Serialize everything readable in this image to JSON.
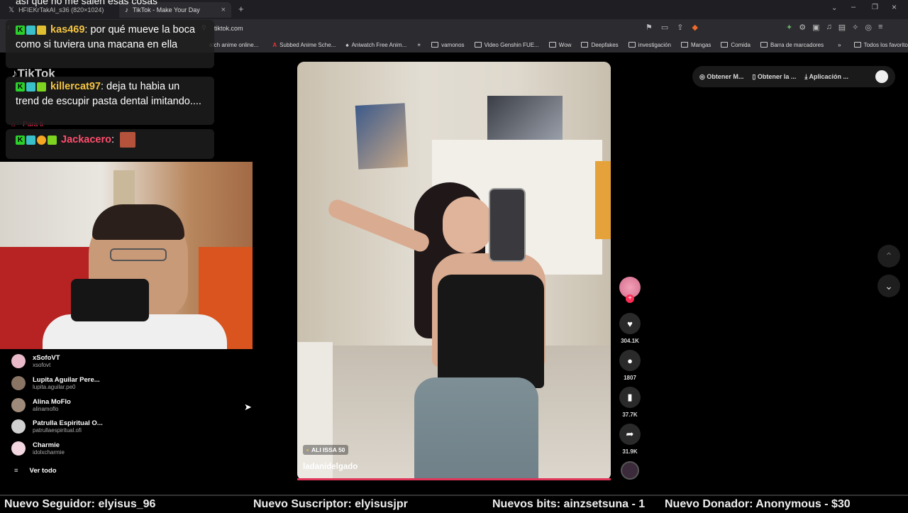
{
  "browser": {
    "tabs": [
      {
        "title": "HFIEKrTakAI_s36 (820×1024)",
        "active": false
      },
      {
        "title": "TikTok - Make Your Day",
        "active": true
      }
    ],
    "url": "tiktok.com",
    "bookmarks": [
      "atch anime online...",
      "Subbed Anime Sche...",
      "Aniwatch Free Anim...",
      "vamonos",
      "Video Genshin FUE...",
      "Wow",
      "Deepfakes",
      "investigación",
      "Mangas",
      "Comida",
      "Barra de marcadores"
    ],
    "all_bookmarks": "Todos los favoritos"
  },
  "tiktok": {
    "logo": "TikTok",
    "nav_para_ti": "Para ti",
    "top_buttons": [
      "Obtener M...",
      "Obtener la ...",
      "Aplicación ..."
    ],
    "video": {
      "badge": "ALI ISSA 50",
      "username": "ladanidelgado"
    },
    "actions": {
      "likes": "304.1K",
      "comments": "1807",
      "saves": "37.7K",
      "shares": "31.9K"
    },
    "following": [
      {
        "name": "xSofoVT",
        "handle": "xsofovt",
        "color": "#e8b9c9"
      },
      {
        "name": "Lupita Aguilar Pere...",
        "handle": "lupita.aguilar.pe0",
        "color": "#8a7565"
      },
      {
        "name": "Alina MoFlo",
        "handle": "alinamoflo",
        "color": "#9e8a7a"
      },
      {
        "name": "Patrulla Espiritual O...",
        "handle": "patrullaespiritual.ofi",
        "color": "#d0d0d0"
      },
      {
        "name": "Charmie",
        "handle": "idolxcharmie",
        "color": "#f2d7e0"
      }
    ],
    "see_all": "Ver todo"
  },
  "chat": {
    "top_partial": "así que no me salen esas cosas",
    "messages": [
      {
        "user": "kas469",
        "user_color": "#f5c542",
        "text": ": por qué mueve la boca como si tuviera una macana en ella"
      },
      {
        "user": "killercat97",
        "user_color": "#f5c542",
        "text": ": deja tu habia un trend de escupir pasta dental imitando...."
      },
      {
        "user": "Jackacero",
        "user_color": "#ff4d6d",
        "text": ":"
      }
    ]
  },
  "ticker": {
    "follower": "Nuevo Seguidor: elyisus_96",
    "subscriber": "Nuevo Suscriptor: elyisusjpr",
    "bits": "Nuevos bits: ainzsetsuna - 1",
    "donor": "Nuevo Donador: Anonymous - $30"
  }
}
